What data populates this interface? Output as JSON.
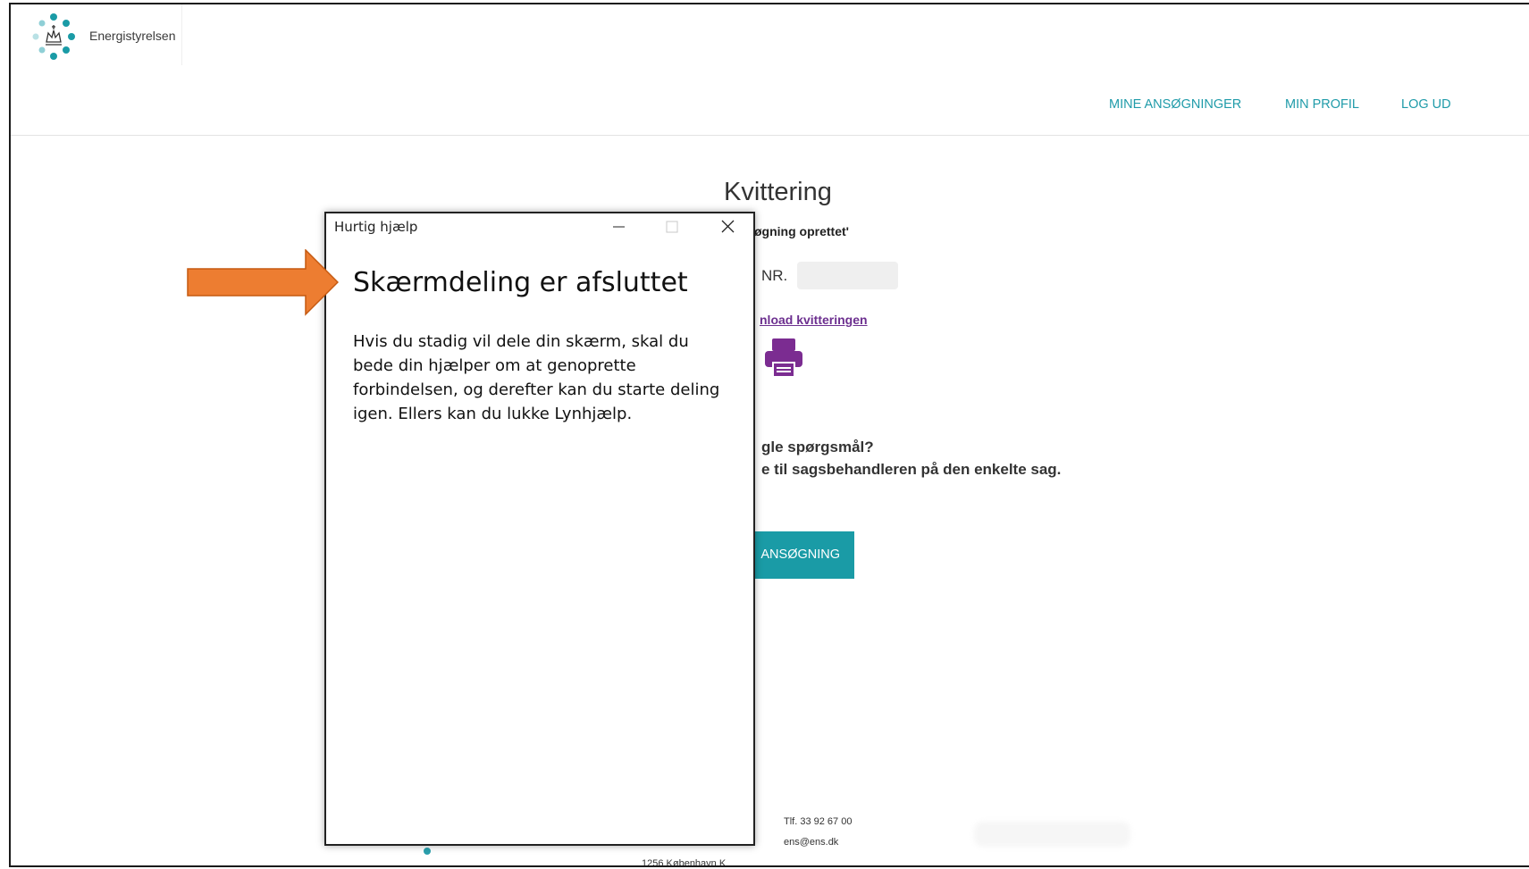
{
  "header": {
    "logo_text": "Energistyrelsen",
    "nav": [
      "MINE ANSØGNINGER",
      "MIN PROFIL",
      "LOG UD"
    ]
  },
  "page": {
    "title": "Kvittering",
    "status_fragment": "øgning oprettet'",
    "ref_label_fragment": "NR.",
    "download_link_fragment": "nload kvitteringen",
    "question_line1": "gle spørgsmål?",
    "question_line2": "e til sagsbehandleren på den enkelte sag.",
    "new_application_button_fragment": "ANSØGNING"
  },
  "footer": {
    "phone": "Tlf. 33 92 67 00",
    "email": "ens@ens.dk",
    "city": "1256 København K"
  },
  "quick_assist": {
    "window_title": "Hurtig hjælp",
    "heading": "Skærmdeling er afsluttet",
    "body": "Hvis du stadig vil dele din skærm, skal du bede din hjælper om at genoprette forbindelsen, og derefter kan du starte deling igen. Ellers kan du lukke Lynhjælp."
  },
  "colors": {
    "accent_teal": "#1a9ba6",
    "link_purple": "#6c2f8f",
    "arrow_orange": "#ed7d31"
  },
  "icons": [
    "logo-dots-icon",
    "printer-icon",
    "minimize-icon",
    "maximize-icon",
    "close-icon",
    "arrow-icon"
  ]
}
